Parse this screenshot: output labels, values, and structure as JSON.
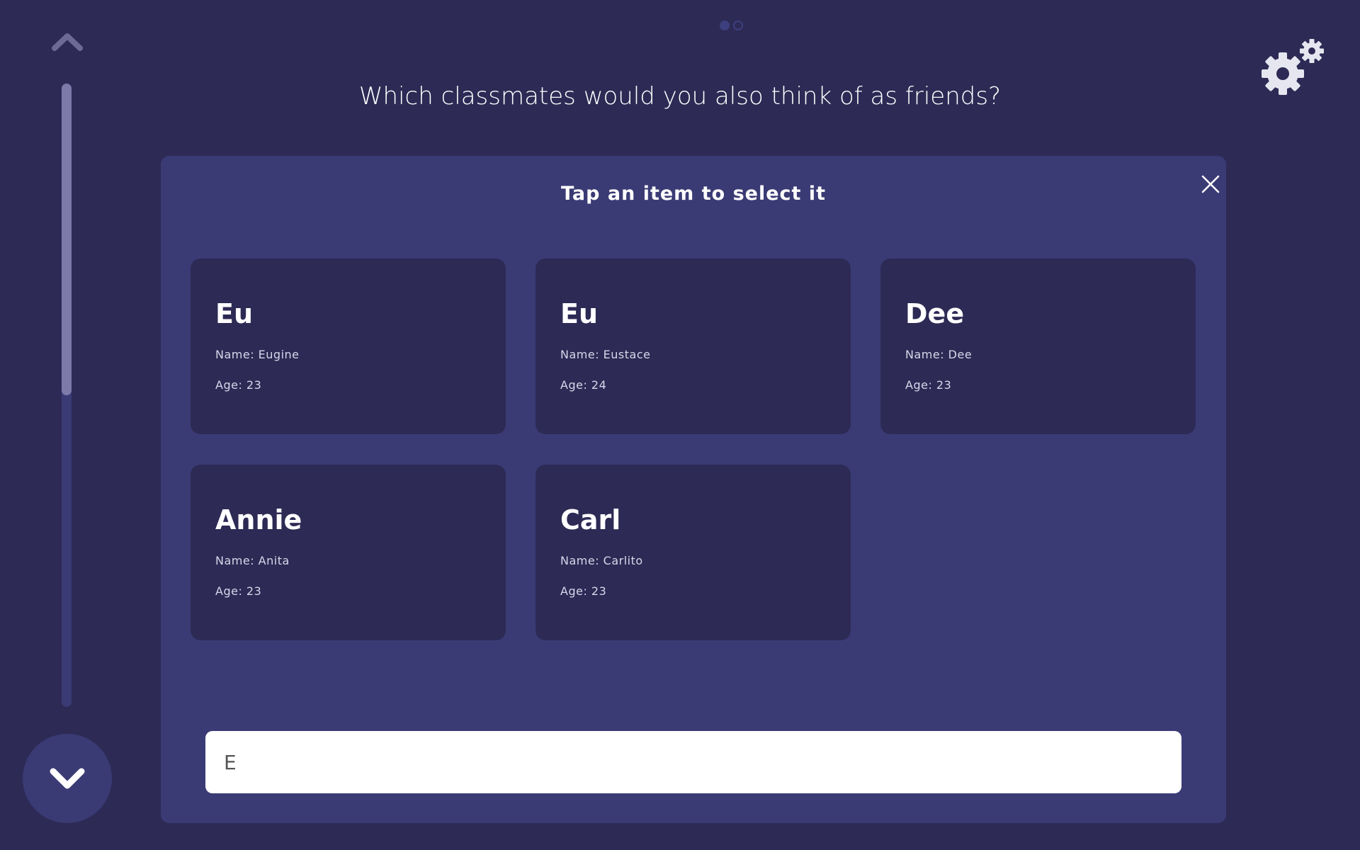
{
  "colors": {
    "background": "#2d2a55",
    "panel": "#3a3b75",
    "card": "#2d2a55",
    "text": "#ffffff",
    "muted_text": "#d8d7ea",
    "scroll_thumb": "#7d7aaa"
  },
  "pagination": {
    "total": 2,
    "current": 1
  },
  "scroll": {
    "position_fraction": 0.0,
    "visible_fraction": 0.5
  },
  "icons": {
    "scroll_up": "chevron-up-icon",
    "scroll_down": "chevron-down-icon",
    "settings": "gear-icon",
    "close": "close-icon"
  },
  "question": "Which classmates would you also think of as friends?",
  "modal": {
    "title": "Tap an item to select it",
    "items": [
      {
        "nickname": "Eu",
        "name": "Name: Eugine",
        "age": "Age: 23"
      },
      {
        "nickname": "Eu",
        "name": "Name: Eustace",
        "age": "Age: 24"
      },
      {
        "nickname": "Dee",
        "name": "Name: Dee",
        "age": "Age: 23"
      },
      {
        "nickname": "Annie",
        "name": "Name: Anita",
        "age": "Age: 23"
      },
      {
        "nickname": "Carl",
        "name": "Name: Carlito",
        "age": "Age: 23"
      }
    ],
    "search": {
      "value": "E",
      "placeholder": ""
    }
  }
}
